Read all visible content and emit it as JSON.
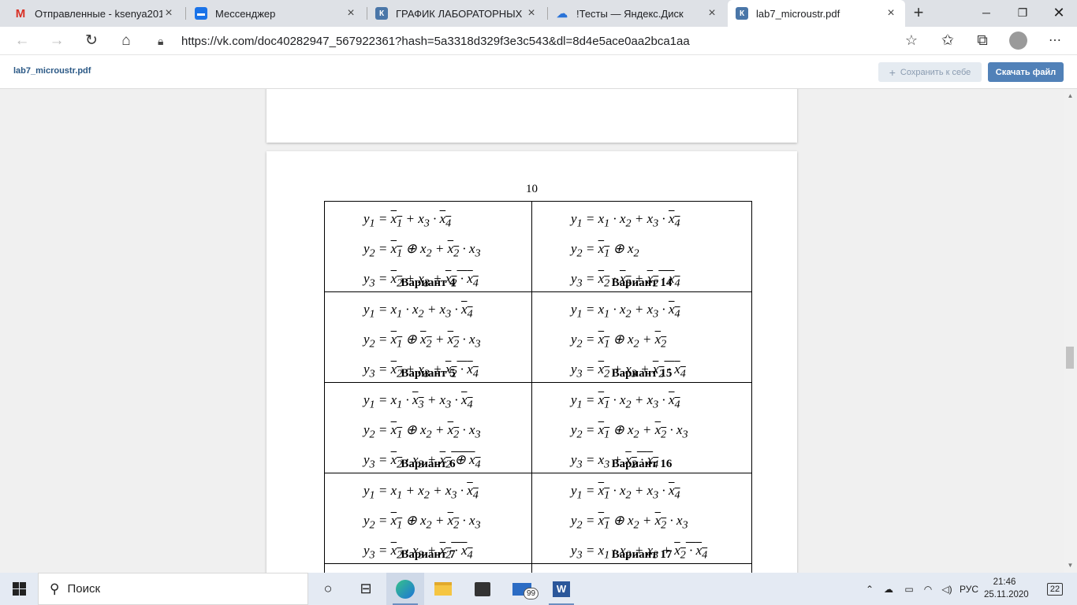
{
  "tabs": [
    {
      "title": "Отправленные - ksenya20133",
      "icon": "gmail-icon",
      "icon_color": "#d93025"
    },
    {
      "title": "Мессенджер",
      "icon": "messenger-icon",
      "icon_color": "#1a73e8"
    },
    {
      "title": "ГРАФИК ЛАБОРАТОРНЫХ РАБ",
      "icon": "vk-icon",
      "icon_color": "#4a76a8"
    },
    {
      "title": "!Тесты — Яндекс.Диск",
      "icon": "yandex-disk-icon",
      "icon_color": "#2a73d8"
    },
    {
      "title": "lab7_microustr.pdf",
      "icon": "vk-icon",
      "icon_color": "#4a76a8",
      "active": true
    }
  ],
  "address": {
    "url": "https://vk.com/doc40282947_567922361?hash=5a3318d329f3e3c543&dl=8d4e5ace0aa2bca1aa"
  },
  "vkbar": {
    "filename": "lab7_microustr.pdf",
    "save_label": "Сохранить к себе",
    "download_label": "Скачать файл"
  },
  "doc": {
    "page_number": "10",
    "variants": [
      [
        "Вариант 4",
        "Вариант 14"
      ],
      [
        "Вариант 5",
        "Вариант 15"
      ],
      [
        "Вариант 6",
        "Вариант 16"
      ],
      [
        "Вариант 7",
        "Вариант 17"
      ]
    ]
  },
  "taskbar": {
    "search_placeholder": "Поиск",
    "mail_badge": "99",
    "lang": "РУС",
    "time": "21:46",
    "date": "25.11.2020",
    "notifications": "22"
  }
}
